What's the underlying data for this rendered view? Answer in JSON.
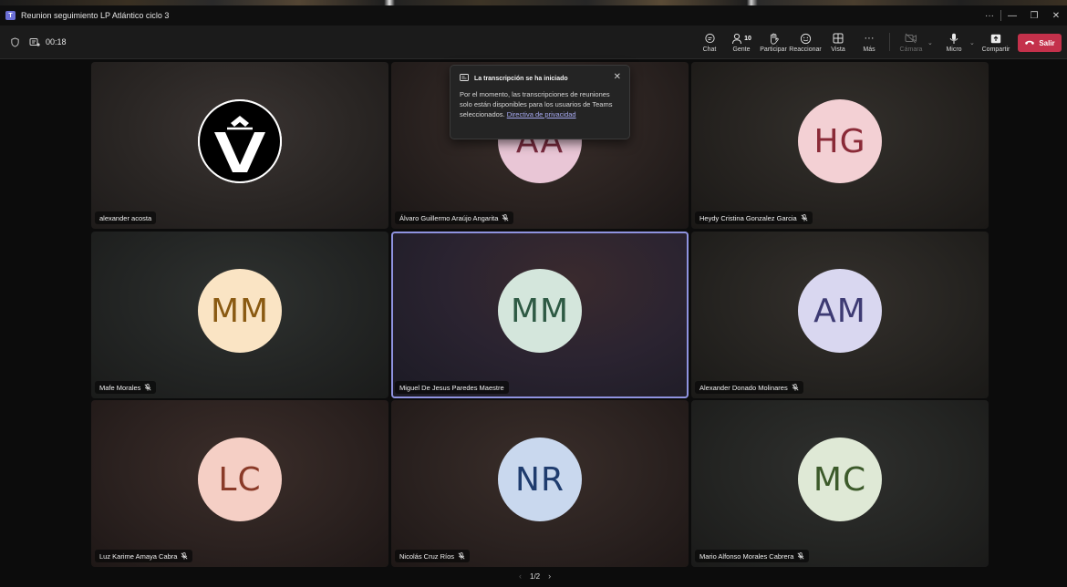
{
  "window": {
    "title": "Reunion seguimiento LP Atlántico ciclo 3",
    "controls": [
      "···",
      "—",
      "❐",
      "✕"
    ]
  },
  "toolbar": {
    "timer": "00:18",
    "buttons": {
      "chat": "Chat",
      "people": "Gente",
      "people_count": "10",
      "raise": "Participar",
      "react": "Reaccionar",
      "view": "Vista",
      "more": "Más",
      "camera": "Cámara",
      "mic": "Micro",
      "share": "Compartir",
      "leave": "Salir"
    },
    "leave_color": "#c4314b"
  },
  "toast": {
    "title": "La transcripción se ha iniciado",
    "body": "Por el momento, las transcripciones de reuniones solo están disponibles para los usuarios de Teams seleccionados.",
    "link": "Directiva de privacidad",
    "close_icon": "close-icon"
  },
  "participants": [
    {
      "name": "alexander acosta",
      "initials": "",
      "avatar_bg": "#ffffff",
      "avatar_fg": "#000000",
      "muted": false,
      "logo": true
    },
    {
      "name": "Álvaro Guillermo Araújo Angarita",
      "initials": "AA",
      "avatar_bg": "#e9c6d6",
      "avatar_fg": "#7a2a3e",
      "muted": true
    },
    {
      "name": "Heydy Cristina Gonzalez Garcia",
      "initials": "HG",
      "avatar_bg": "#f3d0d4",
      "avatar_fg": "#8a2a37",
      "muted": true
    },
    {
      "name": "Mafe Morales",
      "initials": "MM",
      "avatar_bg": "#fae4c4",
      "avatar_fg": "#8a5a12",
      "muted": true
    },
    {
      "name": "Miguel De Jesus Paredes Maestre",
      "initials": "MM",
      "avatar_bg": "#d4e6dc",
      "avatar_fg": "#2e5a44",
      "muted": false,
      "active": true
    },
    {
      "name": "Alexander Donado Molinares",
      "initials": "AM",
      "avatar_bg": "#d9d7f0",
      "avatar_fg": "#3d3a73",
      "muted": true
    },
    {
      "name": "Luz Karime Amaya Cabra",
      "initials": "LC",
      "avatar_bg": "#f5cfc5",
      "avatar_fg": "#8a3a28",
      "muted": true
    },
    {
      "name": "Nicolás Cruz Ríos",
      "initials": "NR",
      "avatar_bg": "#c9d8ee",
      "avatar_fg": "#1f3c6e",
      "muted": true
    },
    {
      "name": "Mario Alfonso Morales Cabrera",
      "initials": "MC",
      "avatar_bg": "#dfe9d6",
      "avatar_fg": "#3c5a2a",
      "muted": true
    }
  ],
  "pager": {
    "label": "1/2"
  }
}
